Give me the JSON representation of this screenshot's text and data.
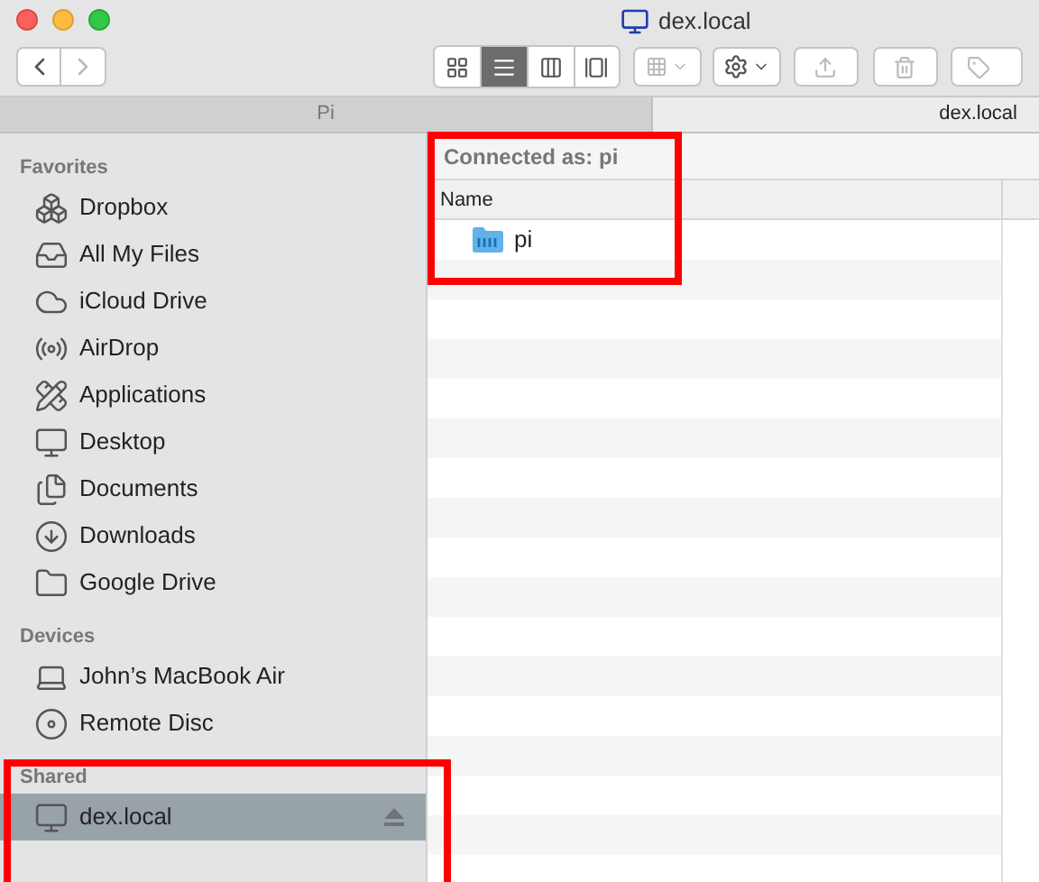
{
  "window": {
    "title": "dex.local"
  },
  "toolbar": {
    "view_modes": [
      {
        "kind": "icons",
        "selected": false
      },
      {
        "kind": "list",
        "selected": true
      },
      {
        "kind": "columns",
        "selected": false
      },
      {
        "kind": "gallery",
        "selected": false
      }
    ]
  },
  "tabs": [
    {
      "label": "Pi",
      "selected": false
    },
    {
      "label": "dex.local",
      "selected": true
    }
  ],
  "sidebar": {
    "sections": [
      {
        "title": "Favorites",
        "items": [
          {
            "label": "Dropbox",
            "kind": "dropbox",
            "selected": false
          },
          {
            "label": "All My Files",
            "kind": "tray",
            "selected": false
          },
          {
            "label": "iCloud Drive",
            "kind": "cloud",
            "selected": false
          },
          {
            "label": "AirDrop",
            "kind": "airdrop",
            "selected": false
          },
          {
            "label": "Applications",
            "kind": "apps",
            "selected": false
          },
          {
            "label": "Desktop",
            "kind": "desktop",
            "selected": false
          },
          {
            "label": "Documents",
            "kind": "documents",
            "selected": false
          },
          {
            "label": "Downloads",
            "kind": "downloads",
            "selected": false
          },
          {
            "label": "Google Drive",
            "kind": "folder",
            "selected": false
          }
        ]
      },
      {
        "title": "Devices",
        "items": [
          {
            "label": "John’s MacBook Air",
            "kind": "laptop",
            "selected": false
          },
          {
            "label": "Remote Disc",
            "kind": "disc",
            "selected": false
          }
        ]
      },
      {
        "title": "Shared",
        "items": [
          {
            "label": "dex.local",
            "kind": "monitor",
            "selected": true,
            "ejectable": true
          }
        ]
      }
    ]
  },
  "content": {
    "status": "Connected as: pi",
    "columns": [
      "Name"
    ],
    "rows": [
      {
        "name": "pi",
        "kind": "share"
      }
    ]
  }
}
